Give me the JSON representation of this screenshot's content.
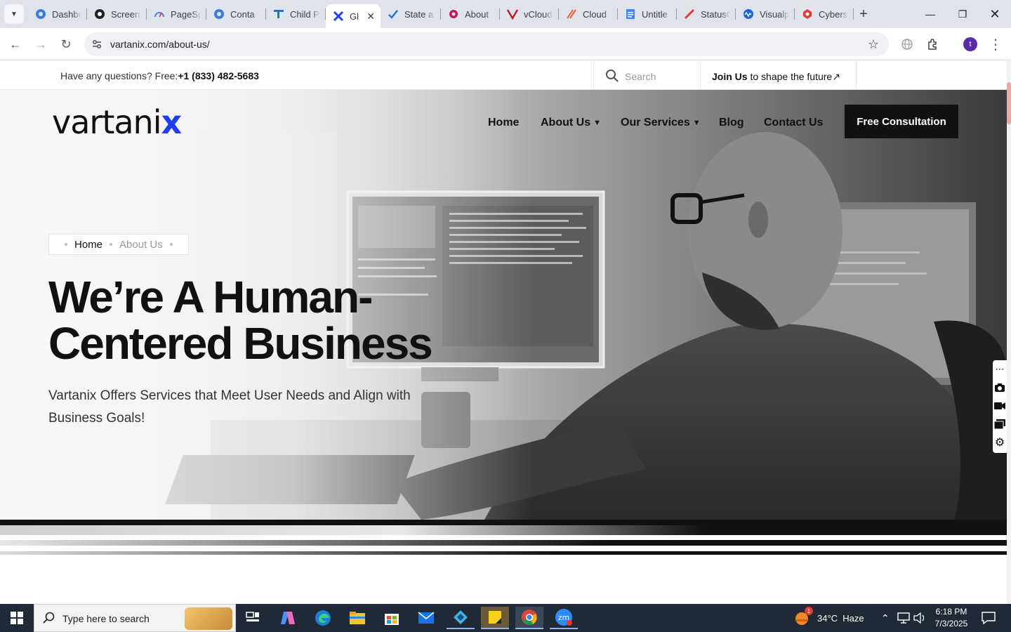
{
  "browser": {
    "tabs": [
      {
        "title": "Dashbo",
        "icon": "globe-blue-icon",
        "active": false
      },
      {
        "title": "Screen",
        "icon": "screencast-icon",
        "active": false
      },
      {
        "title": "PageSp",
        "icon": "pagespeed-icon",
        "active": false
      },
      {
        "title": "Conta",
        "icon": "contact-icon",
        "active": false
      },
      {
        "title": "Child P",
        "icon": "childpage-icon",
        "active": false
      },
      {
        "title": "Gl",
        "icon": "vartanix-x-icon",
        "active": true
      },
      {
        "title": "State a",
        "icon": "check-icon",
        "active": false
      },
      {
        "title": "About",
        "icon": "about-icon",
        "active": false
      },
      {
        "title": "vCloud",
        "icon": "vcloud-icon",
        "active": false
      },
      {
        "title": "Cloud",
        "icon": "cloud-icon",
        "active": false
      },
      {
        "title": "Untitle",
        "icon": "docs-icon",
        "active": false
      },
      {
        "title": "StatusC",
        "icon": "status-icon",
        "active": false
      },
      {
        "title": "Visualp",
        "icon": "visualping-icon",
        "active": false
      },
      {
        "title": "Cybers",
        "icon": "cyber-icon",
        "active": false
      }
    ],
    "url": "vartanix.com/about-us/",
    "profile_initial": "t"
  },
  "site": {
    "topbar": {
      "question": "Have any questions? Free:",
      "phone": "+1 (833) 482-5683",
      "search_placeholder": "Search",
      "join_bold": "Join Us",
      "join_rest": " to shape the future",
      "join_arrow": "↗"
    },
    "logo": {
      "main": "vartani",
      "accent": "x"
    },
    "nav": {
      "home": "Home",
      "about": "About Us",
      "services": "Our Services",
      "blog": "Blog",
      "contact": "Contact Us",
      "cta": "Free Consultation",
      "chevron": "▼"
    },
    "breadcrumb": {
      "home": "Home",
      "current": "About Us"
    },
    "hero": {
      "line1": "We’re A Human-",
      "line2": "Centered Business",
      "subtitle": "Vartanix Offers Services that Meet User Needs and Align with Business Goals!"
    }
  },
  "taskbar": {
    "search_placeholder": "Type here to search",
    "weather": "34°C  Haze",
    "weather_badge": "1",
    "time": "6:18 PM",
    "date": "7/3/2025"
  },
  "colors": {
    "brand_blue": "#1f3ef0",
    "cta_bg": "#111111",
    "taskbar_bg": "#1f2a36"
  }
}
